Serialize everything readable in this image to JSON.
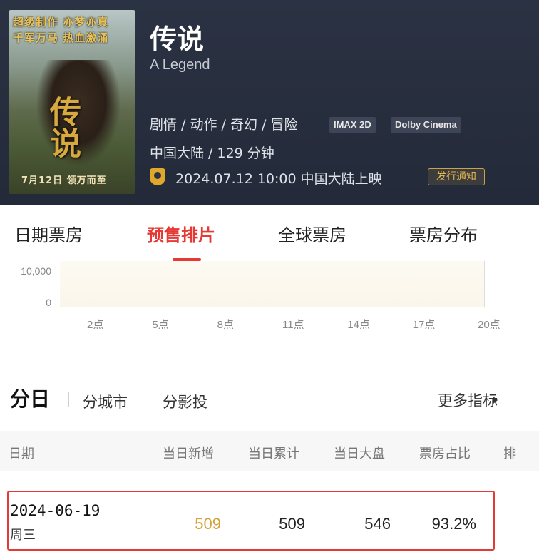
{
  "movie": {
    "title": "传说",
    "english_title": "A Legend",
    "genres": "剧情 / 动作 / 奇幻 / 冒险",
    "formats": [
      "IMAX 2D",
      "Dolby Cinema"
    ],
    "region_duration": "中国大陆 / 129 分钟",
    "release": "2024.07.12 10:00 中国大陆上映",
    "notify_label": "发行通知",
    "poster": {
      "tagline_1": "超级制作 亦梦亦真",
      "tagline_2": "千军万马 热血激涌",
      "title": "传说",
      "date": "7月12日 领万而至"
    }
  },
  "tabs": [
    {
      "label": "日期票房",
      "active": false
    },
    {
      "label": "预售排片",
      "active": true
    },
    {
      "label": "全球票房",
      "active": false
    },
    {
      "label": "票房分布",
      "active": false
    }
  ],
  "chart_data": {
    "type": "area",
    "y_ticks": [
      "10,000",
      "0"
    ],
    "x_ticks": [
      "2点",
      "5点",
      "8点",
      "11点",
      "14点",
      "17点",
      "20点"
    ],
    "ylim": [
      0,
      10000
    ],
    "series": []
  },
  "subtabs": {
    "active": "分日",
    "items": [
      "分城市",
      "分影投"
    ],
    "more_label": "更多指标"
  },
  "table": {
    "headers": [
      "日期",
      "当日新增",
      "当日累计",
      "当日大盘",
      "票房占比",
      "排"
    ],
    "rows": [
      {
        "date": "2024-06-19",
        "weekday": "周三",
        "daily_new": "509",
        "daily_total": "509",
        "market": "546",
        "share": "93.2%"
      }
    ]
  },
  "colors": {
    "accent": "#e53935",
    "gold": "#d4a23a",
    "header_bg": "#2b3243"
  }
}
